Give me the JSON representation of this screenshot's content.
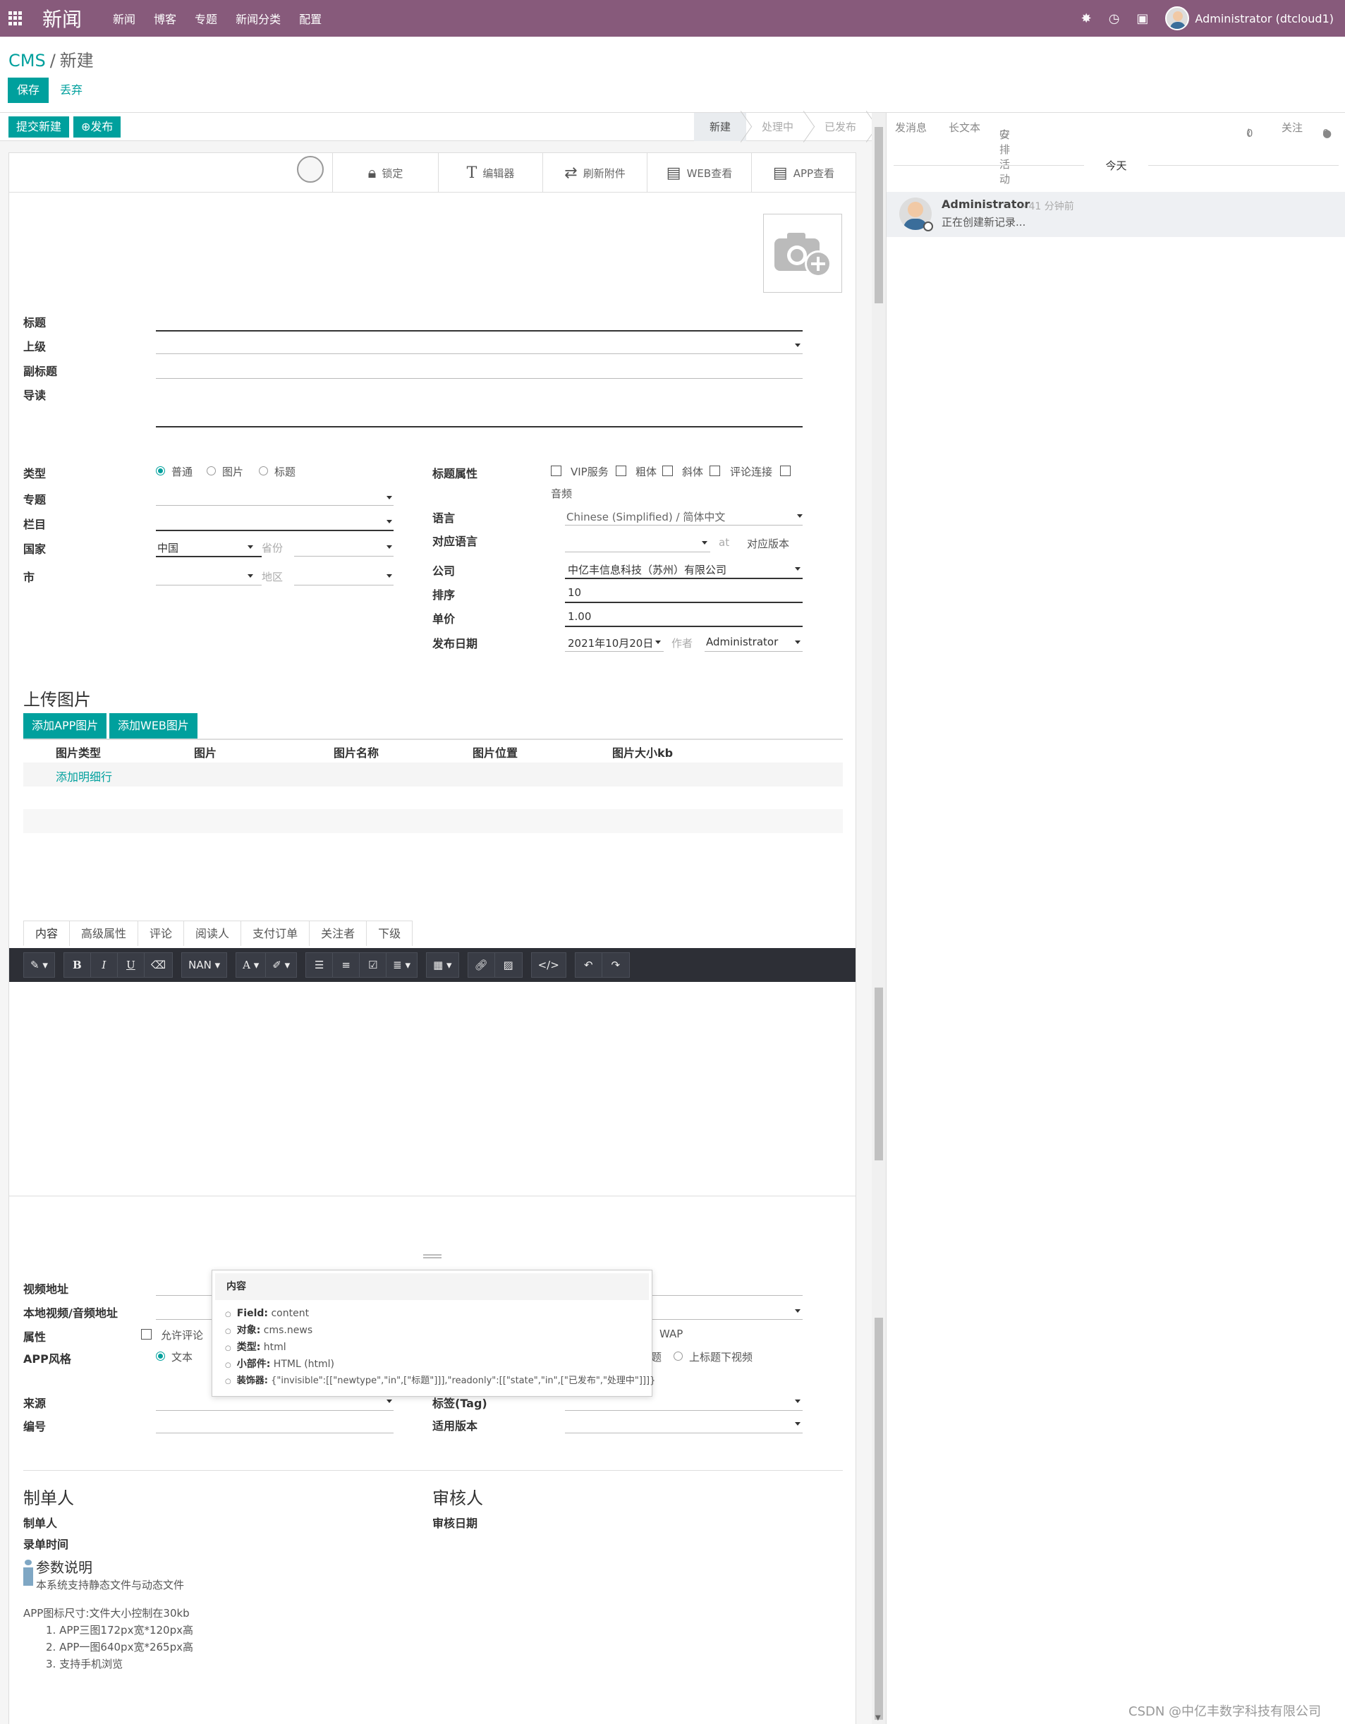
{
  "topbar": {
    "brand": "新闻",
    "menu": [
      "新闻",
      "博客",
      "专题",
      "新闻分类",
      "配置"
    ],
    "user": "Administrator (dtcloud1)"
  },
  "breadcrumb": {
    "parent": "CMS",
    "current": "新建"
  },
  "actions": {
    "save": "保存",
    "discard": "丢弃"
  },
  "status_buttons": {
    "submit": "提交新建",
    "publish": "发布"
  },
  "stages": [
    "新建",
    "处理中",
    "已发布"
  ],
  "smart_buttons": {
    "lock": "锁定",
    "editor": "编辑器",
    "refresh": "刷新附件",
    "web": "WEB查看",
    "app": "APP查看"
  },
  "fields": {
    "title": "标题",
    "parent": "上级",
    "subtitle": "副标题",
    "intro": "导读",
    "type": "类型",
    "type_options": [
      "普通",
      "图片",
      "标题"
    ],
    "topic": "专题",
    "column": "栏目",
    "country": "国家",
    "country_value": "中国",
    "province_ph": "省份",
    "city": "市",
    "district_ph": "地区",
    "title_attr": "标题属性",
    "title_attr_options": [
      "VIP服务",
      "粗体",
      "斜体",
      "评论连接",
      "音频"
    ],
    "language": "语言",
    "language_value": "Chinese (Simplified) / 简体中文",
    "corr_lang": "对应语言",
    "at": "at",
    "corr_version": "对应版本",
    "company": "公司",
    "company_value": "中亿丰信息科技（苏州）有限公司",
    "sequence": "排序",
    "sequence_value": "10",
    "price": "单价",
    "price_value": "1.00",
    "publish_date": "发布日期",
    "publish_date_value": "2021年10月20日",
    "author_label": "作者",
    "author_value": "Administrator"
  },
  "upload": {
    "heading": "上传图片",
    "add_app": "添加APP图片",
    "add_web": "添加WEB图片",
    "columns": [
      "图片类型",
      "图片",
      "图片名称",
      "图片位置",
      "图片大小kb"
    ],
    "add_line": "添加明细行"
  },
  "tabs": [
    "内容",
    "高级属性",
    "评论",
    "阅读人",
    "支付订单",
    "关注者",
    "下级"
  ],
  "editor_toolbar": {
    "font_size": "NAN"
  },
  "lower": {
    "video_url": "视频地址",
    "local_media": "本地视频/音频地址",
    "attributes": "属性",
    "allow_comment": "允许评论",
    "wap": "WAP",
    "app_style": "APP风格",
    "style_text": "文本",
    "style_video_under": "上标题下视频",
    "style_partial": "题",
    "source": "来源",
    "tag": "标签(Tag)",
    "number": "编号",
    "version": "适用版本"
  },
  "maker": {
    "heading": "制单人",
    "maker": "制单人",
    "entry_time": "录单时间",
    "reviewer_heading": "审核人",
    "review_date": "审核日期"
  },
  "notes": {
    "heading": "参数说明",
    "line1": "本系统支持静态文件与动态文件",
    "line2": "APP图标尺寸:文件大小控制在30kb",
    "items": [
      "1. APP三图172px宽*120px高",
      "2. APP一图640px宽*265px高",
      "3. 支持手机浏览"
    ]
  },
  "chatter": {
    "send": "发消息",
    "note": "长文本",
    "activity": "安排活动",
    "attach_count": "0",
    "follow": "关注",
    "follower_count": "0",
    "today": "今天",
    "author": "Administrator",
    "time": "- 41 分钟前",
    "body": "正在创建新记录..."
  },
  "tooltip": {
    "title": "内容",
    "field_label": "Field:",
    "field": "content",
    "object_label": "对象:",
    "object": "cms.news",
    "type_label": "类型:",
    "type": "html",
    "widget_label": "小部件:",
    "widget": "HTML (html)",
    "modifiers_label": "装饰器:",
    "modifiers": "{\"invisible\":[[\"newtype\",\"in\",[\"标题\"]]],\"readonly\":[[\"state\",\"in\",[\"已发布\",\"处理中\"]]]}"
  },
  "watermark": "CSDN @中亿丰数字科技有限公司",
  "colors": {
    "topbar": "#875a7b",
    "accent": "#00a09d",
    "toolbar": "#2d2f36"
  }
}
